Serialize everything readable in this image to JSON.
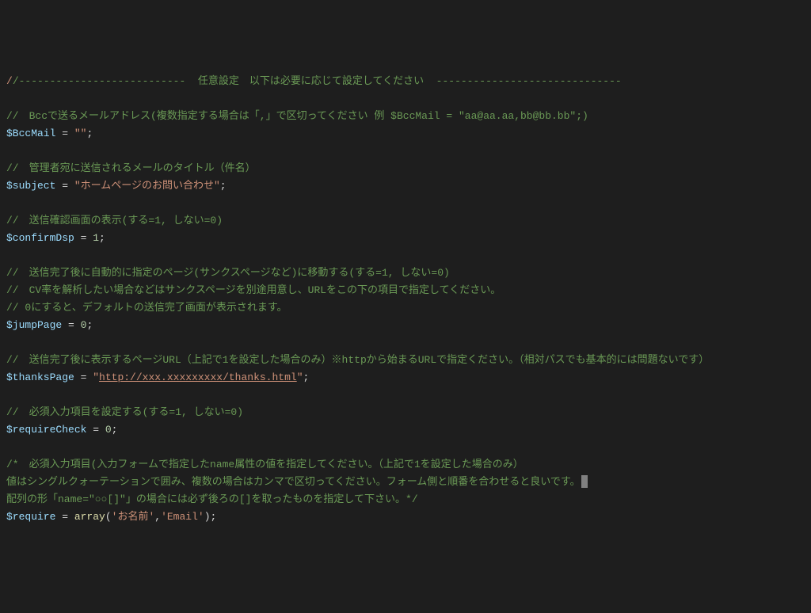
{
  "code": {
    "header_slash": "/",
    "header_text": "/---------------------------  任意設定　以下は必要に応じて設定してください  ------------------------------",
    "bcc_comment": "//　Bccで送るメールアドレス(複数指定する場合は「,」で区切ってください 例 $BccMail = \"aa@aa.aa,bb@bb.bb\";)",
    "bcc_var": "$BccMail",
    "bcc_eq": " = ",
    "bcc_val": "\"\"",
    "semi": ";",
    "subject_comment": "//　管理者宛に送信されるメールのタイトル（件名）",
    "subject_var": "$subject",
    "subject_eq": " = ",
    "subject_val": "\"ホームページのお問い合わせ\"",
    "confirm_comment": "//　送信確認画面の表示(する=1, しない=0)",
    "confirm_var": "$confirmDsp",
    "confirm_eq": " = ",
    "confirm_val": "1",
    "jump_comment1": "//　送信完了後に自動的に指定のページ(サンクスページなど)に移動する(する=1, しない=0)",
    "jump_comment2": "//　CV率を解析したい場合などはサンクスページを別途用意し、URLをこの下の項目で指定してください。",
    "jump_comment3": "// 0にすると、デフォルトの送信完了画面が表示されます。",
    "jump_var": "$jumpPage",
    "jump_eq": " = ",
    "jump_val": "0",
    "thanks_comment": "//　送信完了後に表示するページURL（上記で1を設定した場合のみ）※httpから始まるURLで指定ください。（相対パスでも基本的には問題ないです）",
    "thanks_var": "$thanksPage",
    "thanks_eq": " = ",
    "thanks_quote": "\"",
    "thanks_url": "http://xxx.xxxxxxxxx/thanks.html",
    "thanks_quote2": "\"",
    "require_check_comment": "//　必須入力項目を設定する(する=1, しない=0)",
    "require_check_var": "$requireCheck",
    "require_check_eq": " = ",
    "require_check_val": "0",
    "require_comment1": "/*　必須入力項目(入力フォームで指定したname属性の値を指定してください。（上記で1を設定した場合のみ）",
    "require_comment2": "値はシングルクォーテーションで囲み、複数の場合はカンマで区切ってください。フォーム側と順番を合わせると良いです。",
    "require_comment3": "配列の形「name=\"○○[]\"」の場合には必ず後ろの[]を取ったものを指定して下さい。*/",
    "require_var": "$require",
    "require_eq": " = ",
    "array_fn": "array",
    "require_paren_open": "(",
    "require_arg1": "'お名前'",
    "require_comma": ",",
    "require_arg2": "'Email'",
    "require_paren_close": ")"
  }
}
